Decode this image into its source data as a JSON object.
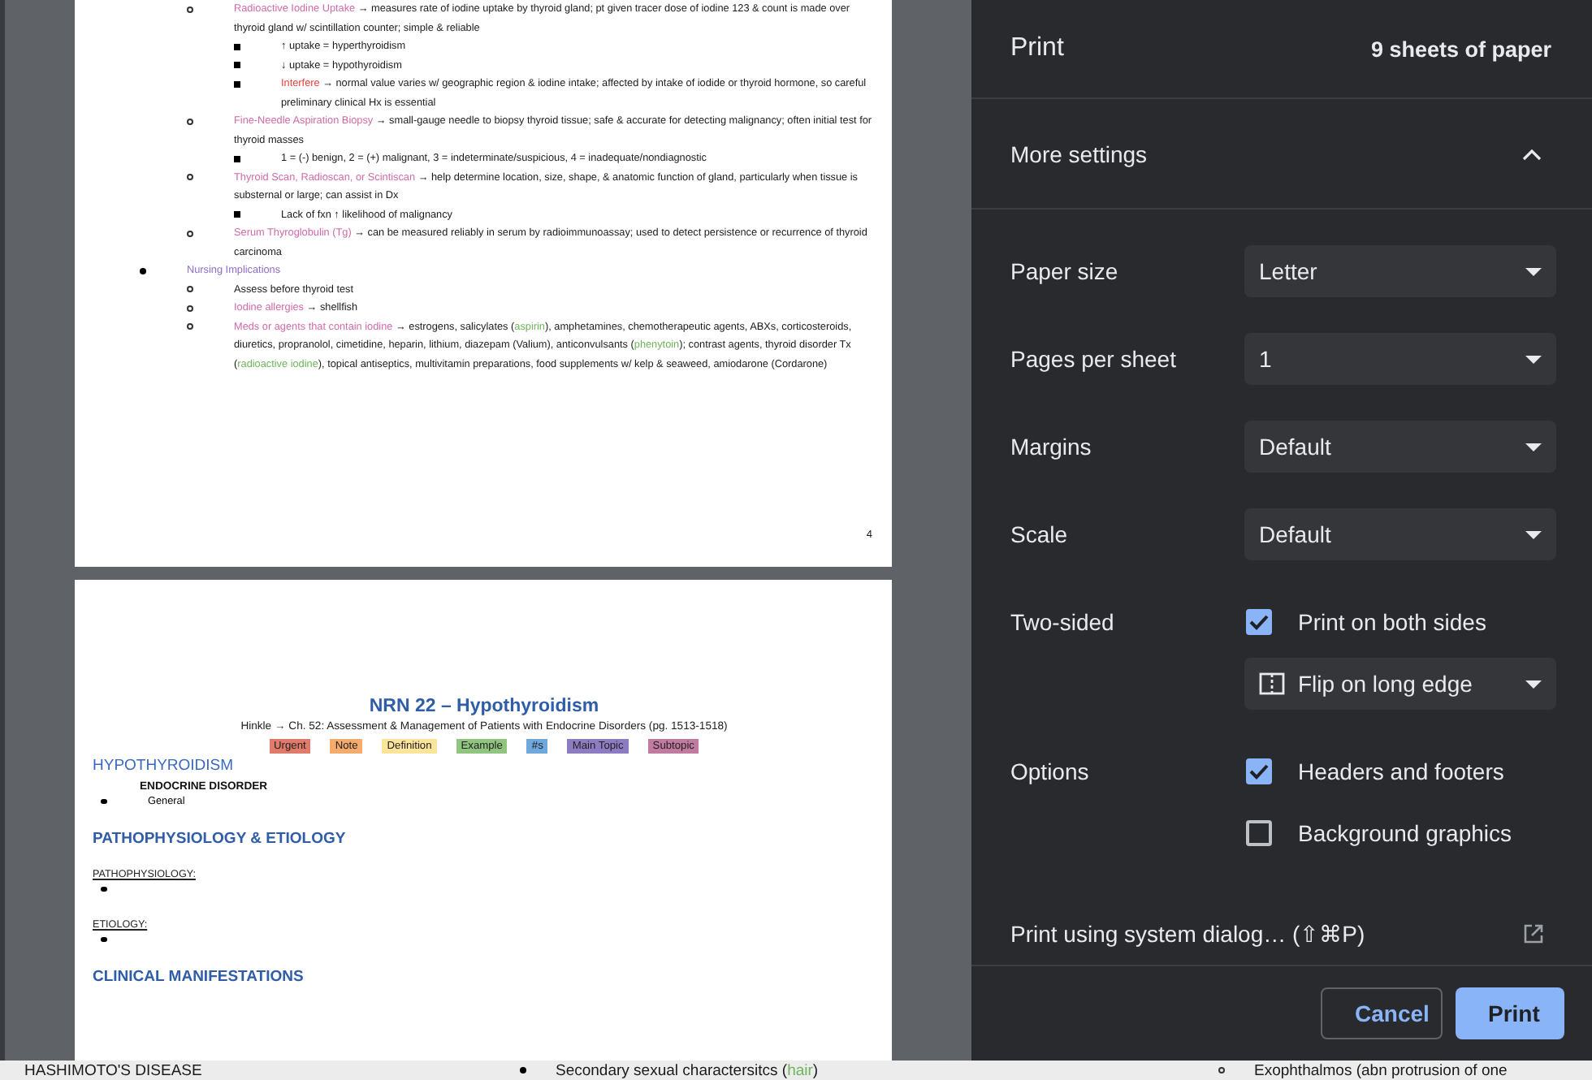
{
  "preview": {
    "page_top": {
      "blocks": [
        {
          "kind": "continued",
          "items": [
            {
              "segments": [
                {
                  "kind": "subtopic",
                  "text": "Radioactive Iodine Uptake"
                },
                {
                  "kind": "plain",
                  "text": " → measures rate of iodine uptake by thyroid gland; pt given tracer dose of iodine 123 & count is made over thyroid gland w/ scintillation counter; simple & reliable"
                }
              ],
              "children": [
                {
                  "segments": [
                    {
                      "kind": "plain",
                      "text": "↑ uptake = hyperthyroidism"
                    }
                  ]
                },
                {
                  "segments": [
                    {
                      "kind": "plain",
                      "text": "↓ uptake = hypothyroidism"
                    }
                  ]
                },
                {
                  "segments": [
                    {
                      "kind": "urgent",
                      "text": "Interfere"
                    },
                    {
                      "kind": "plain",
                      "text": " → normal value varies w/ geographic region & iodine intake; affected by intake of iodide or thyroid hormone, so careful preliminary clinical Hx is essential"
                    }
                  ]
                }
              ]
            },
            {
              "segments": [
                {
                  "kind": "subtopic",
                  "text": "Fine-Needle Aspiration Biopsy"
                },
                {
                  "kind": "plain",
                  "text": " → small-gauge needle to biopsy thyroid tissue; safe & accurate for detecting malignancy; often initial test for thyroid masses"
                }
              ],
              "children": [
                {
                  "segments": [
                    {
                      "kind": "plain",
                      "text": "1 = (-) benign, 2 = (+) malignant, 3 = indeterminate/suspicious, 4 = inadequate/nondiagnostic"
                    }
                  ]
                }
              ]
            },
            {
              "segments": [
                {
                  "kind": "subtopic",
                  "text": "Thyroid Scan, Radioscan, or Scintiscan"
                },
                {
                  "kind": "plain",
                  "text": " → help determine location, size, shape, & anatomic function of gland, particularly when tissue is substernal or large; can assist in Dx"
                }
              ],
              "children": [
                {
                  "segments": [
                    {
                      "kind": "plain",
                      "text": "Lack of fxn ↑ likelihood of malignancy"
                    }
                  ]
                }
              ]
            },
            {
              "segments": [
                {
                  "kind": "subtopic",
                  "text": "Serum Thyroglobulin (Tg)"
                },
                {
                  "kind": "plain",
                  "text": " → can be measured reliably in serum by radioimmunoassay; used to detect persistence or recurrence of thyroid carcinoma"
                }
              ]
            }
          ]
        },
        {
          "kind": "list",
          "items": [
            {
              "segments": [
                {
                  "kind": "topic",
                  "text": "Nursing Implications"
                }
              ],
              "children": [
                {
                  "segments": [
                    {
                      "kind": "plain",
                      "text": "Assess before thyroid test"
                    }
                  ]
                },
                {
                  "segments": [
                    {
                      "kind": "subtopic",
                      "text": "Iodine allergies"
                    },
                    {
                      "kind": "plain",
                      "text": " → shellfish"
                    }
                  ]
                },
                {
                  "segments": [
                    {
                      "kind": "subtopic",
                      "text": "Meds or agents that contain iodine"
                    },
                    {
                      "kind": "plain",
                      "text": " → estrogens, salicylates ("
                    },
                    {
                      "kind": "example",
                      "text": "aspirin"
                    },
                    {
                      "kind": "plain",
                      "text": "), amphetamines, chemotherapeutic agents, ABXs, corticosteroids, diuretics, propranolol, cimetidine, heparin, lithium, diazepam (Valium), anticonvulsants ("
                    },
                    {
                      "kind": "example",
                      "text": "phenytoin"
                    },
                    {
                      "kind": "plain",
                      "text": "); contrast agents, thyroid disorder Tx ("
                    },
                    {
                      "kind": "example",
                      "text": "radioactive iodine"
                    },
                    {
                      "kind": "plain",
                      "text": "), topical antiseptics, multivitamin preparations, food supplements w/ kelp & seaweed, amiodarone (Cordarone)"
                    }
                  ]
                }
              ]
            }
          ]
        }
      ],
      "page_number": "4"
    },
    "page_bottom": {
      "title": "NRN 22 – Hypothyroidism",
      "subtitle": "Hinkle → Ch. 52: Assessment & Management of Patients with Endocrine Disorders (pg. 1513-1518)",
      "legend": [
        {
          "text": "Urgent",
          "color": "#e07a6a"
        },
        {
          "text": "Note",
          "color": "#f5ab6e"
        },
        {
          "text": "Definition",
          "color": "#fde49b"
        },
        {
          "text": "Example",
          "color": "#8fc57e"
        },
        {
          "text": "#s",
          "color": "#6fa8dc"
        },
        {
          "text": "Main Topic",
          "color": "#8e7cc3"
        },
        {
          "text": "Subtopic",
          "color": "#c27ba0"
        }
      ],
      "lines": [
        {
          "kind": "heading",
          "text": "HYPOTHYROIDISM"
        },
        {
          "kind": "label",
          "text": "ENDOCRINE DISORDER"
        },
        {
          "kind": "bullet",
          "text": "General"
        },
        {
          "kind": "major",
          "text": "PATHOPHYSIOLOGY & ETIOLOGY"
        },
        {
          "kind": "sublabel",
          "text": "PATHOPHYSIOLOGY:"
        },
        {
          "kind": "empty-bullet"
        },
        {
          "kind": "sublabel",
          "text": "ETIOLOGY:"
        },
        {
          "kind": "empty-bullet"
        },
        {
          "kind": "major",
          "text": "CLINICAL MANIFESTATIONS"
        }
      ]
    }
  },
  "background_document": [
    {
      "kind": "text",
      "segments": [
        {
          "kind": "plain",
          "text": "HASHIMOTO'S DISEASE"
        }
      ]
    },
    {
      "kind": "bullet",
      "segments": [
        {
          "kind": "plain",
          "text": "Secondary sexual charactersitcs ("
        },
        {
          "kind": "example",
          "text": "hair"
        },
        {
          "kind": "plain",
          "text": ")"
        }
      ]
    },
    {
      "kind": "sub-bullet",
      "segments": [
        {
          "kind": "plain",
          "text": "Exophthalmos (abn protrusion of one"
        }
      ]
    }
  ],
  "print_panel": {
    "title": "Print",
    "sheets": "9 sheets of paper",
    "more_settings": {
      "label": "More settings",
      "expanded": true
    },
    "settings": [
      {
        "label": "Paper size",
        "kind": "select",
        "value": "Letter"
      },
      {
        "label": "Pages per sheet",
        "kind": "select",
        "value": "1"
      },
      {
        "label": "Margins",
        "kind": "select",
        "value": "Default"
      },
      {
        "label": "Scale",
        "kind": "select",
        "value": "Default"
      },
      {
        "label": "Two-sided",
        "kind": "group",
        "items": [
          {
            "kind": "checkbox",
            "text": "Print on both sides",
            "checked": true
          },
          {
            "kind": "select",
            "value": "Flip on long edge"
          }
        ]
      },
      {
        "label": "Options",
        "kind": "group",
        "items": [
          {
            "kind": "checkbox",
            "text": "Headers and footers",
            "checked": true
          },
          {
            "kind": "checkbox",
            "text": "Background graphics",
            "checked": false
          }
        ]
      }
    ],
    "system_dialog": "Print using system dialog… (⇧⌘P)",
    "buttons": [
      {
        "text": "Cancel",
        "kind": "secondary"
      },
      {
        "text": "Print",
        "kind": "primary"
      }
    ]
  }
}
